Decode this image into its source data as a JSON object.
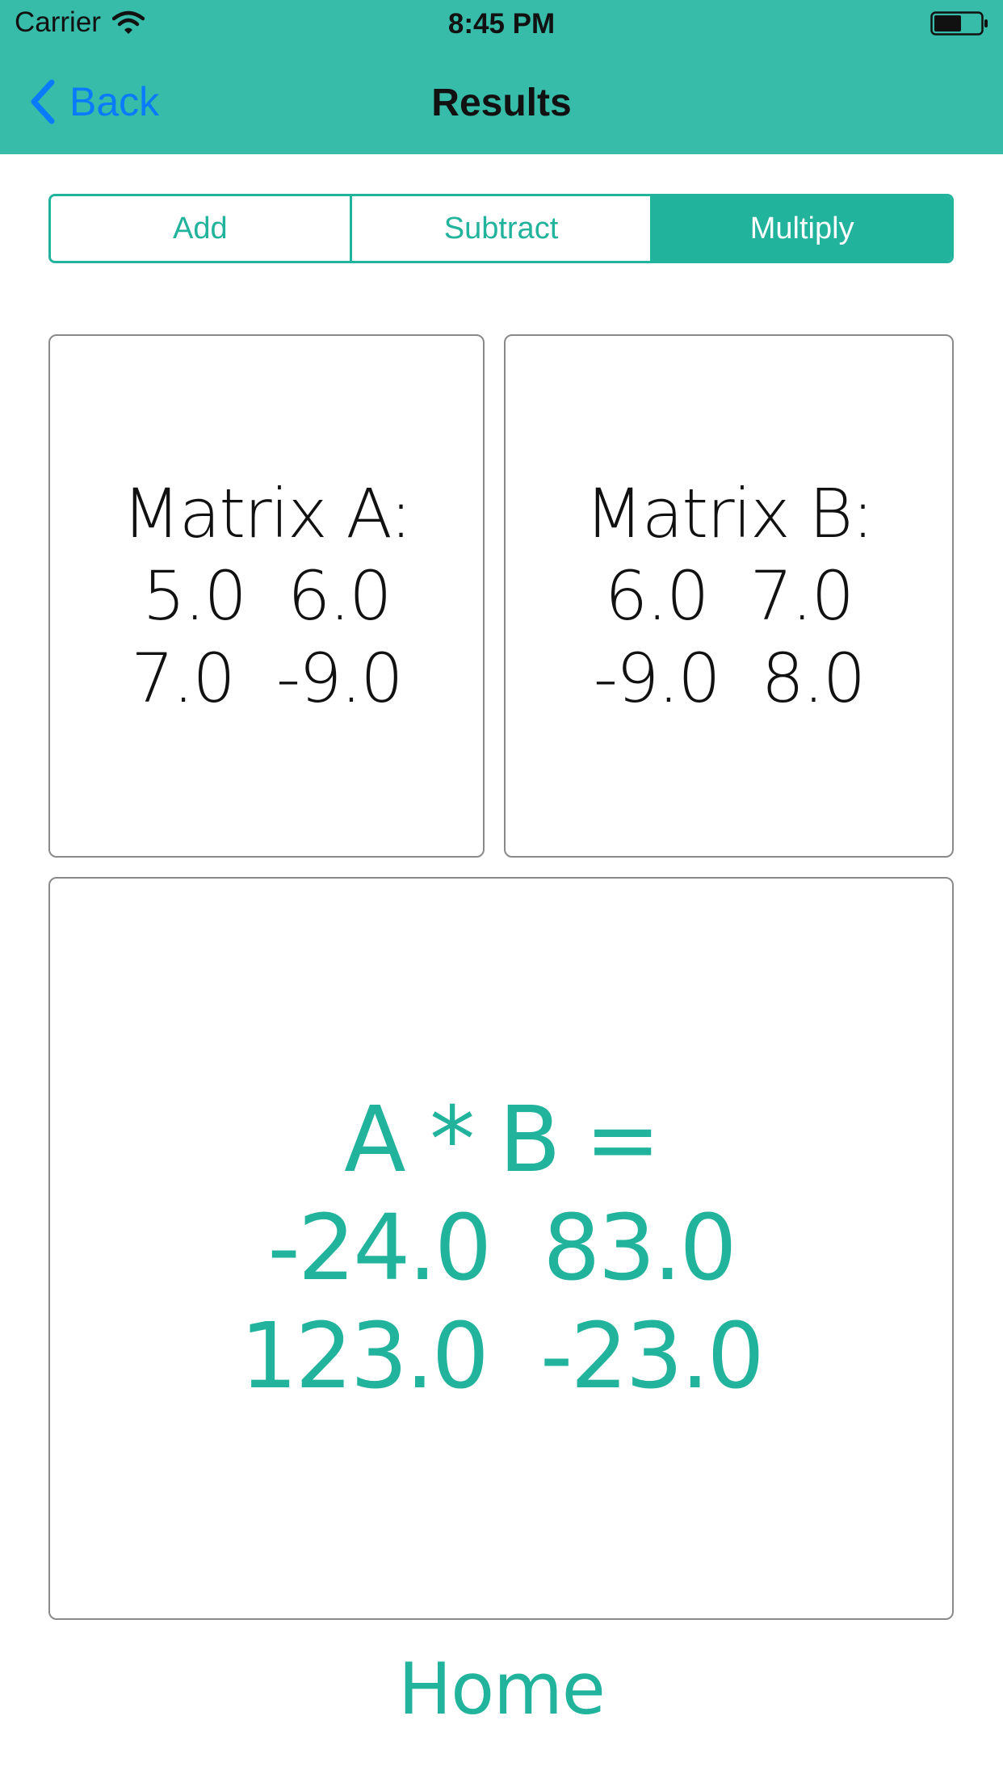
{
  "status_bar": {
    "carrier": "Carrier",
    "time": "8:45 PM"
  },
  "navbar": {
    "back_label": "Back",
    "title": "Results"
  },
  "segmented_control": {
    "segments": [
      "Add",
      "Subtract",
      "Multiply"
    ],
    "selected": "Multiply"
  },
  "matrix_a": {
    "title": "Matrix A:",
    "rows": [
      [
        "5.0",
        "6.0"
      ],
      [
        "7.0",
        "-9.0"
      ]
    ]
  },
  "matrix_b": {
    "title": "Matrix B:",
    "rows": [
      [
        "6.0",
        "7.0"
      ],
      [
        "-9.0",
        "8.0"
      ]
    ]
  },
  "result": {
    "title": "A * B =",
    "rows": [
      [
        "-24.0",
        "83.0"
      ],
      [
        "123.0",
        "-23.0"
      ]
    ]
  },
  "home_label": "Home",
  "colors": {
    "header_bg": "#37bca9",
    "accent": "#22b39d",
    "ios_blue": "#0a7bff"
  },
  "icons": [
    "wifi-icon",
    "battery-icon",
    "back-chevron-icon"
  ]
}
